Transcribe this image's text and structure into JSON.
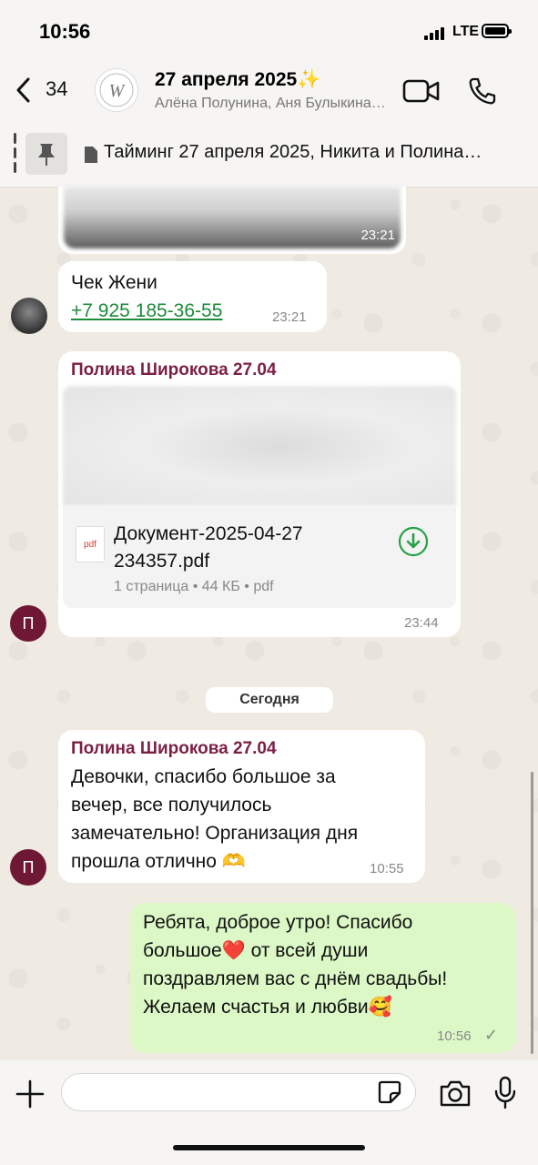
{
  "status_bar": {
    "time": "10:56",
    "network": "LTE"
  },
  "header": {
    "back_count": "34",
    "title": "27 апреля 2025✨",
    "subtitle": "Алёна Полунина, Аня Булыкина…"
  },
  "pinned": {
    "text": "Тайминг 27 апреля 2025, Никита и Полина…"
  },
  "messages": [
    {
      "time": "23:21"
    },
    {
      "text": "Чек Жени",
      "phone": "+7 925 185-36-55",
      "time": "23:21"
    },
    {
      "sender": "Полина Широкова 27.04",
      "document": {
        "icon_label": "pdf",
        "name_line1": "Документ-2025-04-27",
        "name_line2": "234357.pdf",
        "meta": "1 страница • 44 КБ • pdf"
      },
      "time": "23:44",
      "avatar_letter": "П"
    },
    {
      "sender": "Полина Широкова 27.04",
      "lines": [
        "Девочки, спасибо большое за",
        "вечер, все получилось",
        "замечательно! Организация дня",
        "прошла отлично 🫶"
      ],
      "time": "10:55",
      "avatar_letter": "П"
    },
    {
      "lines": [
        "Ребята, доброе утро! Спасибо",
        "большое❤️ от всей души",
        "поздравляем вас с днём свадьбы!",
        "Желаем счастья и любви🥰"
      ],
      "time": "10:56",
      "status": "✓"
    }
  ],
  "date_divider": "Сегодня",
  "colors": {
    "sender": "#7a1f45",
    "outgoing": "#dcf8c6",
    "link": "#1e8a3a",
    "wallpaper": "#efeae2"
  }
}
